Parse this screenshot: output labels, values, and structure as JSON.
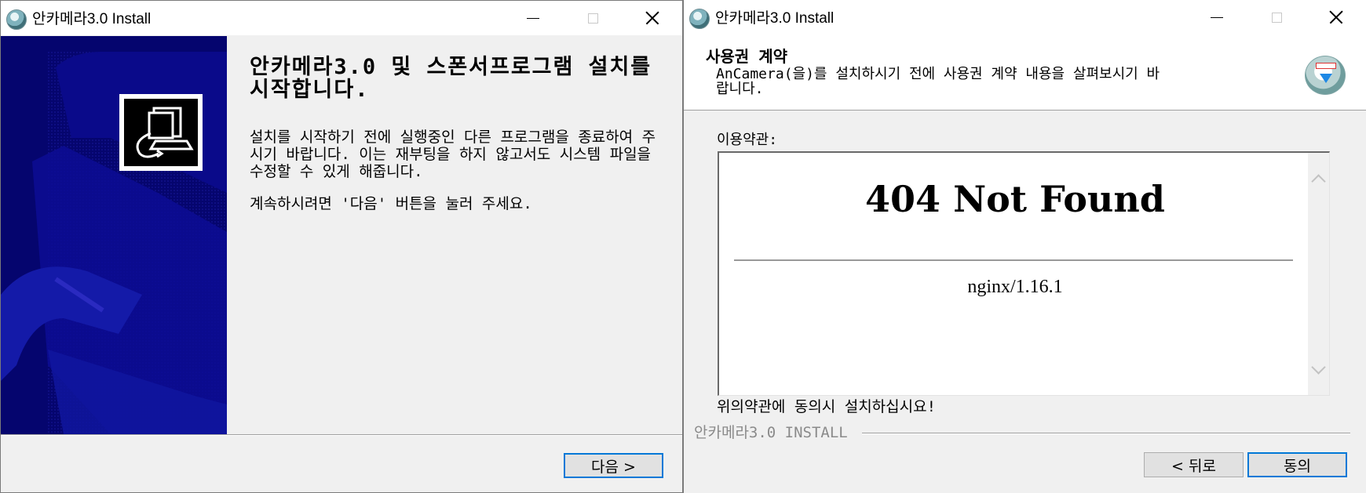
{
  "window1": {
    "title": "안카메라3.0 Install",
    "welcome_title": "안카메라3.0 및 스폰서프로그램 설치를 시작합니다.",
    "welcome_body": "설치를 시작하기 전에 실행중인 다른 프로그램을 종료하여 주시기 바랍니다. 이는 재부팅을 하지 않고서도 시스템 파일을 수정할 수 있게 해줍니다.",
    "welcome_continue": "계속하시려면 '다음' 버튼을 눌러 주세요.",
    "next_button": "다음 >"
  },
  "window2": {
    "title": "안카메라3.0 Install",
    "header_title": "사용권 계약",
    "header_subtitle": "AnCamera(을)를 설치하시기 전에 사용권 계약 내용을 살펴보시기 바랍니다.",
    "terms_label": "이용약관:",
    "terms_content": {
      "heading": "404 Not Found",
      "server": "nginx/1.16.1"
    },
    "agree_note": "위의약관에 동의시 설치하십시요!",
    "brand": "안카메라3.0 INSTALL",
    "back_button": "< 뒤로",
    "agree_button": "동의"
  },
  "colors": {
    "side_panel": "#05056e",
    "default_button_border": "#0078d7",
    "dialog_bg": "#f0f0f0"
  },
  "icons": [
    "installer-app-icon",
    "minimize-icon",
    "maximize-icon",
    "close-icon",
    "installer-computer-icon",
    "installer-package-icon",
    "scroll-up-icon",
    "scroll-down-icon"
  ]
}
